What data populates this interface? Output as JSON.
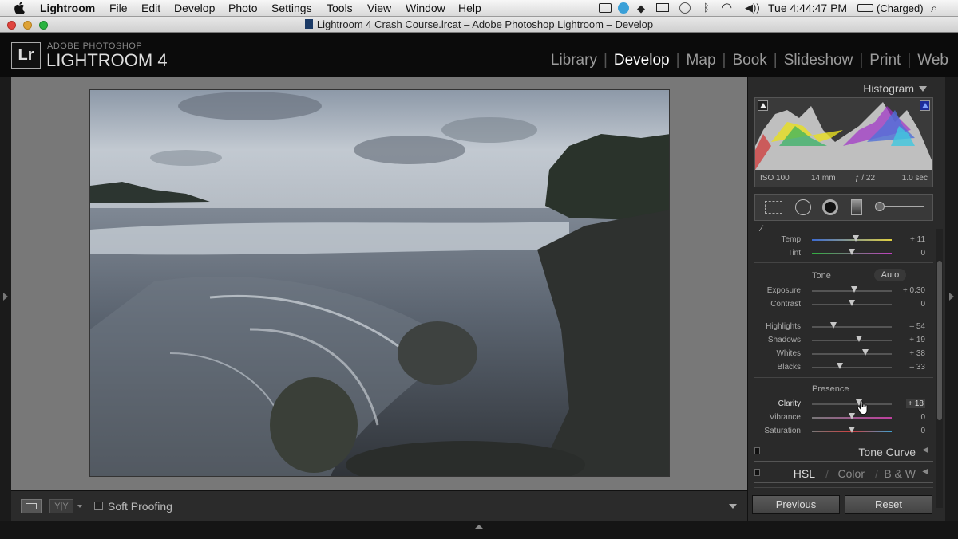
{
  "menubar": {
    "apple": "",
    "items": [
      "Lightroom",
      "File",
      "Edit",
      "Develop",
      "Photo",
      "Settings",
      "Tools",
      "View",
      "Window",
      "Help"
    ],
    "status": {
      "time": "Tue 4:44:47 PM",
      "battery": "(Charged)"
    }
  },
  "titlebar": {
    "title": "Lightroom 4 Crash Course.lrcat – Adobe Photoshop Lightroom – Develop"
  },
  "lr": {
    "logo": "Lr",
    "brand_line1": "ADOBE PHOTOSHOP",
    "brand_line2": "LIGHTROOM 4",
    "modules": [
      "Library",
      "Develop",
      "Map",
      "Book",
      "Slideshow",
      "Print",
      "Web"
    ],
    "active_module": "Develop"
  },
  "toolbar": {
    "soft_proofing": "Soft Proofing"
  },
  "panel": {
    "histogram_title": "Histogram",
    "meta": {
      "iso": "ISO 100",
      "focal": "14 mm",
      "aperture": "ƒ / 22",
      "shutter": "1.0 sec"
    },
    "wb": [
      {
        "label": "Temp",
        "value": "+ 11",
        "pos": 0.55
      },
      {
        "label": "Tint",
        "value": "0",
        "pos": 0.5
      }
    ],
    "tone_label": "Tone",
    "auto_label": "Auto",
    "tone1": [
      {
        "label": "Exposure",
        "value": "+ 0.30",
        "pos": 0.53
      },
      {
        "label": "Contrast",
        "value": "0",
        "pos": 0.5
      }
    ],
    "tone2": [
      {
        "label": "Highlights",
        "value": "– 54",
        "pos": 0.27
      },
      {
        "label": "Shadows",
        "value": "+ 19",
        "pos": 0.59
      },
      {
        "label": "Whites",
        "value": "+ 38",
        "pos": 0.67
      },
      {
        "label": "Blacks",
        "value": "– 33",
        "pos": 0.35
      }
    ],
    "presence_label": "Presence",
    "presence": [
      {
        "label": "Clarity",
        "value": "+ 18",
        "pos": 0.59
      },
      {
        "label": "Vibrance",
        "value": "0",
        "pos": 0.5
      },
      {
        "label": "Saturation",
        "value": "0",
        "pos": 0.5
      }
    ],
    "tone_curve": "Tone Curve",
    "hsl": "HSL",
    "color": "Color",
    "bw": "B & W",
    "previous": "Previous",
    "reset": "Reset"
  },
  "colors": {
    "accent": "#4a78c8",
    "panel_bg": "#2a2a2a",
    "viewer_bg": "#787878"
  }
}
